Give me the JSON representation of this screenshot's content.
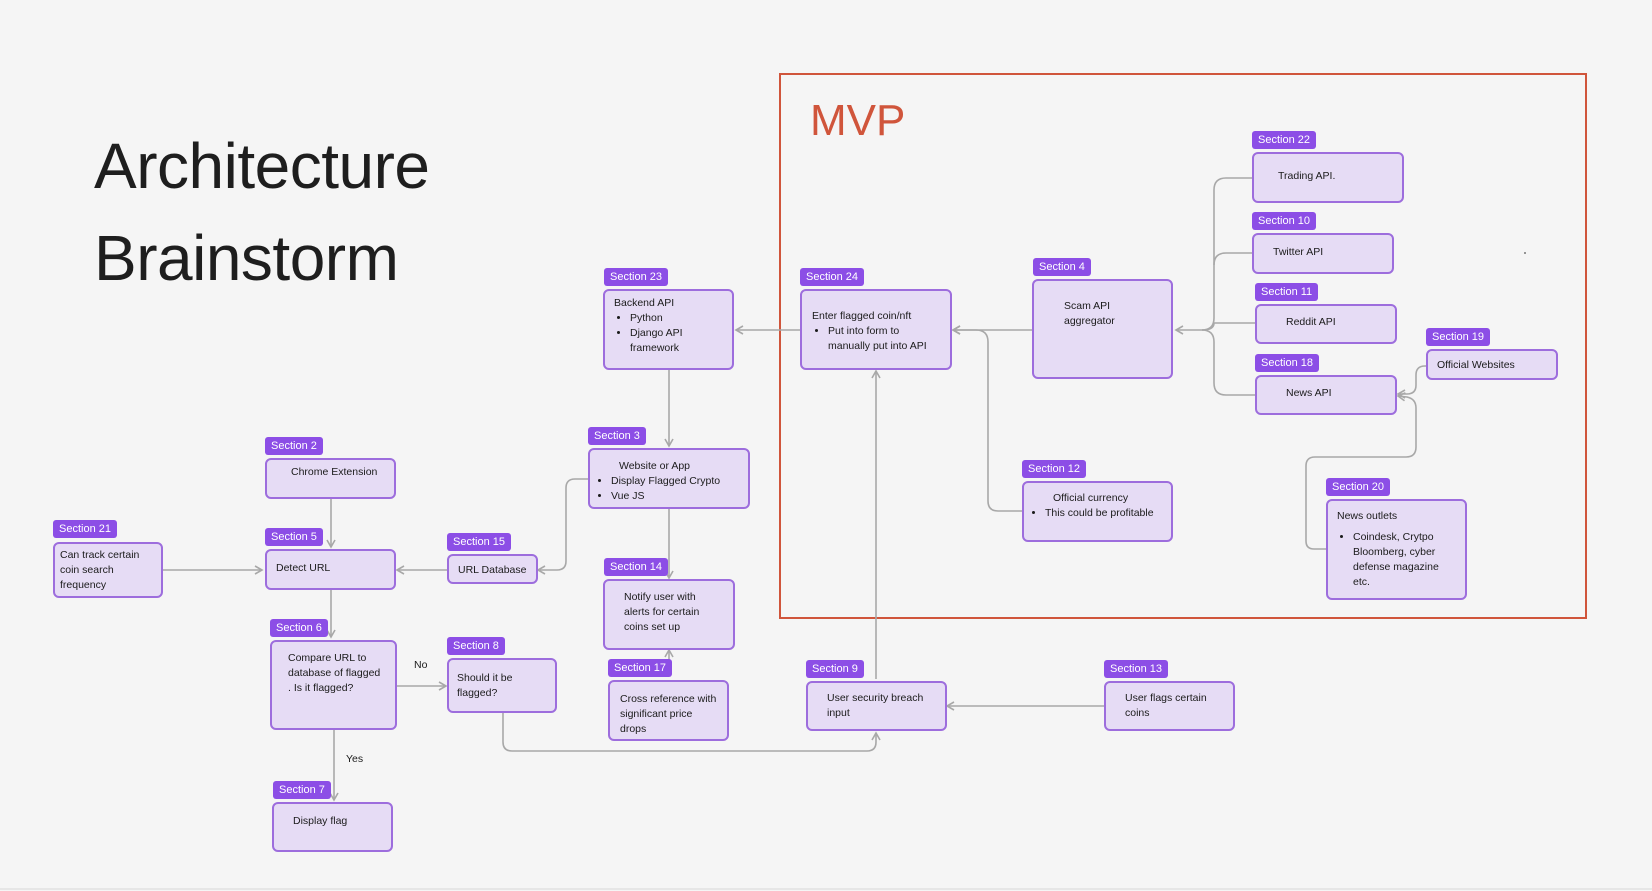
{
  "title_line1": "Architecture",
  "title_line2": "Brainstorm",
  "mvp_label": "MVP",
  "colors": {
    "node_fill": "#e6dcf5",
    "node_border": "#9d6ddd",
    "tag": "#8c4ee6",
    "mvp": "#d0553b",
    "connector": "#a8a8a8"
  },
  "edge_labels": {
    "no": "No",
    "yes": "Yes"
  },
  "nodes": {
    "s2": {
      "tag": "Section 2",
      "text": "Chrome Extension",
      "bullets": []
    },
    "s3": {
      "tag": "Section 3",
      "text": "Website or App",
      "bullets": [
        "Display Flagged Crypto",
        "Vue JS"
      ]
    },
    "s4": {
      "tag": "Section 4",
      "text": "Scam API aggregator",
      "bullets": []
    },
    "s5": {
      "tag": "Section 5",
      "text": "Detect URL",
      "bullets": []
    },
    "s6": {
      "tag": "Section 6",
      "text": "Compare URL to database of flagged . Is it flagged?",
      "bullets": []
    },
    "s7": {
      "tag": "Section 7",
      "text": "Display flag",
      "bullets": []
    },
    "s8": {
      "tag": "Section 8",
      "text": "Should it be flagged?",
      "bullets": []
    },
    "s9": {
      "tag": "Section 9",
      "text": "User security breach input",
      "bullets": []
    },
    "s10": {
      "tag": "Section 10",
      "text": "Twitter API",
      "bullets": []
    },
    "s11": {
      "tag": "Section 11",
      "text": "Reddit API",
      "bullets": []
    },
    "s12": {
      "tag": "Section 12",
      "text": "Official currency",
      "bullets": [
        "This could be profitable"
      ]
    },
    "s13": {
      "tag": "Section 13",
      "text": "User flags certain coins",
      "bullets": []
    },
    "s14": {
      "tag": "Section 14",
      "text": "Notify user with alerts for certain coins set up",
      "bullets": []
    },
    "s15": {
      "tag": "Section 15",
      "text": "URL Database",
      "bullets": []
    },
    "s17": {
      "tag": "Section 17",
      "text": "Cross reference with significant price drops",
      "bullets": []
    },
    "s18": {
      "tag": "Section 18",
      "text": "News API",
      "bullets": []
    },
    "s19": {
      "tag": "Section 19",
      "text": "Official Websites",
      "bullets": []
    },
    "s20": {
      "tag": "Section 20",
      "text": "News outlets",
      "bullets": [
        "Coindesk, Crytpo Bloomberg, cyber defense magazine etc."
      ]
    },
    "s21": {
      "tag": "Section 21",
      "text": "Can track certain coin search frequency",
      "bullets": []
    },
    "s22": {
      "tag": "Section 22",
      "text": "Trading API.",
      "bullets": []
    },
    "s23": {
      "tag": "Section 23",
      "text": "Backend API",
      "bullets": [
        "Python",
        "Django API framework"
      ]
    },
    "s24": {
      "tag": "Section 24",
      "text": "Enter flagged coin/nft",
      "bullets": [
        "Put into form to manually put into API"
      ]
    }
  }
}
